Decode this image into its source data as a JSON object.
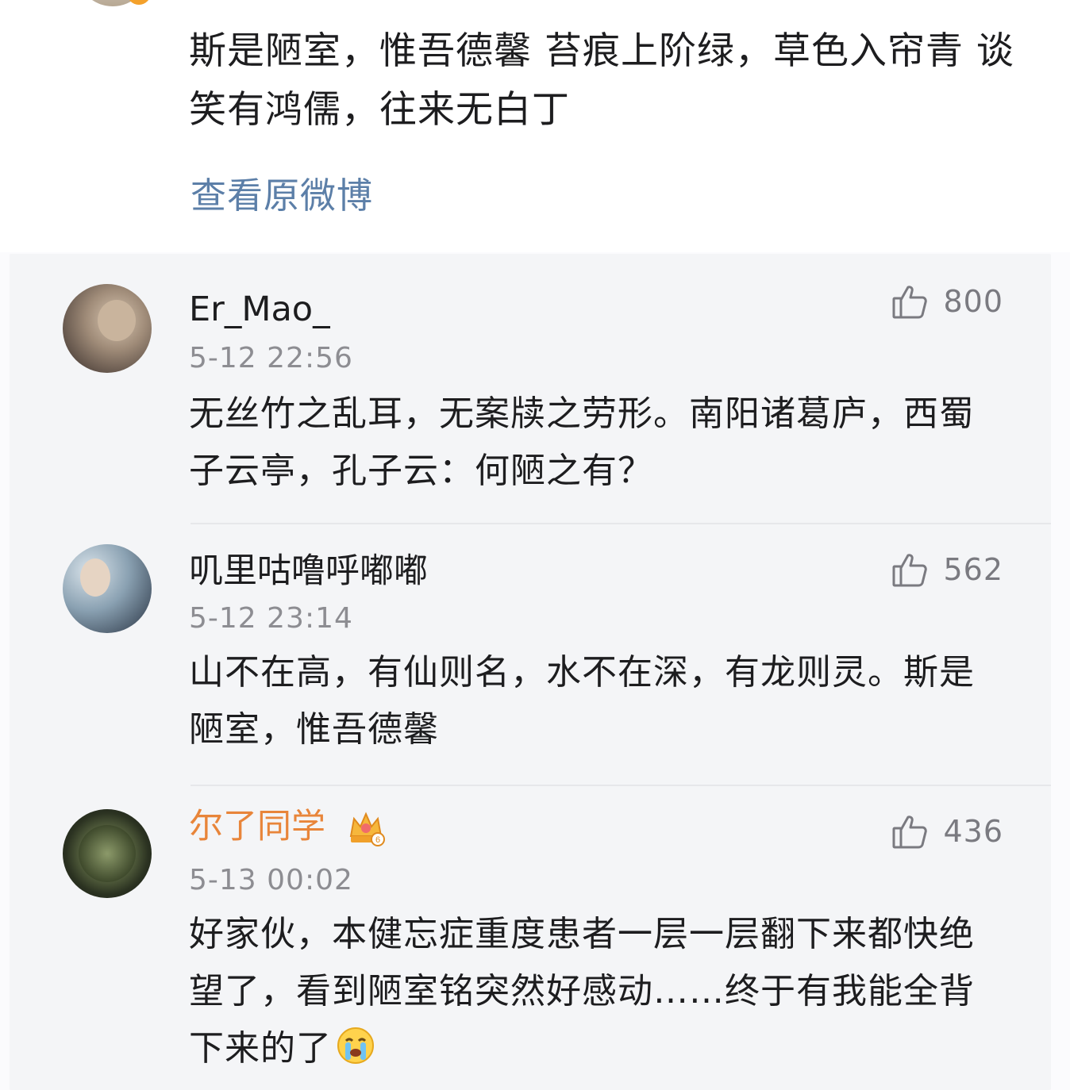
{
  "post": {
    "text": "斯是陋室，惟吾德馨 苔痕上阶绿，草色入帘青 谈笑有鸿儒，往来无白丁",
    "view_original_label": "查看原微博"
  },
  "comments": [
    {
      "username": "Er_Mao_",
      "time": "5-12 22:56",
      "likes": "800",
      "content": "无丝竹之乱耳，无案牍之劳形。南阳诸葛庐，西蜀子云亭，孔子云：何陋之有？",
      "avatar_icon": "cat-avatar"
    },
    {
      "username": "叽里咕噜呼嘟嘟",
      "time": "5-12 23:14",
      "likes": "562",
      "content": "山不在高，有仙则名，水不在深，有龙则灵。斯是陋室，惟吾德馨",
      "avatar_icon": "person-avatar"
    },
    {
      "username": "尔了同学",
      "username_color": "#e8853a",
      "badge_icon": "vip-crown-icon",
      "time": "5-13 00:02",
      "likes": "436",
      "content": "好家伙，本健忘症重度患者一层一层翻下来都快绝望了，看到陋室铭突然好感动……终于有我能全背下来的了",
      "emoji_icon": "crying-face-icon",
      "avatar_icon": "dark-green-avatar"
    }
  ],
  "colors": {
    "link": "#5c7fa8",
    "text": "#1d1d1f",
    "muted": "#8d8d92",
    "vip_name": "#e8853a"
  }
}
